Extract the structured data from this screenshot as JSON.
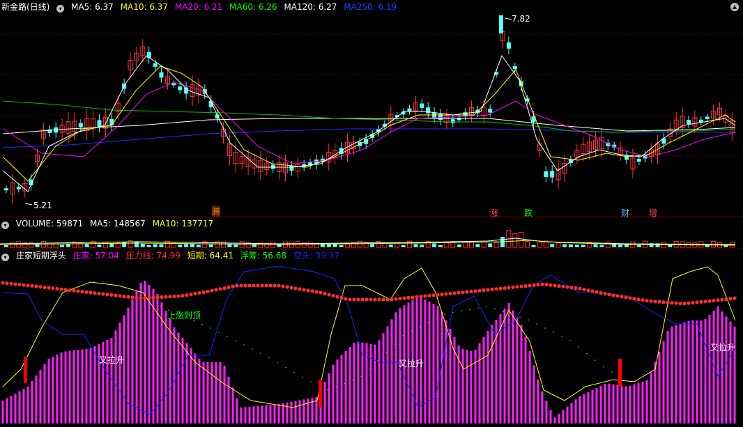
{
  "price_pane": {
    "stock_title": "新金路(日线)",
    "ma": [
      {
        "label": "MA5: 6.37",
        "color": "#ffffff"
      },
      {
        "label": "MA10: 6.37",
        "color": "#ffff00"
      },
      {
        "label": "MA20: 6.21",
        "color": "#ff00ff"
      },
      {
        "label": "MA60: 6.26",
        "color": "#00ff00"
      },
      {
        "label": "MA120: 6.27",
        "color": "#ffffff"
      },
      {
        "label": "MA250: 6.19",
        "color": "#0000ff"
      }
    ],
    "high_label": "7.82",
    "low_label": "5.21",
    "markers": [
      {
        "text": "腾",
        "color": "#ff8000"
      },
      {
        "text": "涨",
        "color": "#ff4040"
      },
      {
        "text": "跌",
        "color": "#00ff00"
      },
      {
        "text": "财",
        "color": "#4fc3ff"
      },
      {
        "text": "增",
        "color": "#ff4040"
      }
    ]
  },
  "volume_pane": {
    "label": "VOLUME: 59871",
    "ma5": "MA5: 148567",
    "ma10": "MA10: 137717"
  },
  "indicator_pane": {
    "name": "庄家短期浮头",
    "lines": [
      {
        "label": "庄家: 57.04",
        "color": "#ff00ff"
      },
      {
        "label": "压力线: 74.99",
        "color": "#ff3030"
      },
      {
        "label": "短期: 64.41",
        "color": "#ffff00"
      },
      {
        "label": "浮筹: 56.68",
        "color": "#00ff00"
      },
      {
        "label": "空头: 39.37",
        "color": "#2020ff"
      }
    ],
    "annotations": [
      {
        "text": "又拉升",
        "color": "#ffffff"
      },
      {
        "text": "上涨到顶",
        "color": "#00ff00"
      },
      {
        "text": "又拉升",
        "color": "#ffffff"
      },
      {
        "text": "又拉升",
        "color": "#ffffff"
      }
    ]
  },
  "colors": {
    "up": "#ff3232",
    "down": "#54ffff",
    "background": "#000000"
  }
}
